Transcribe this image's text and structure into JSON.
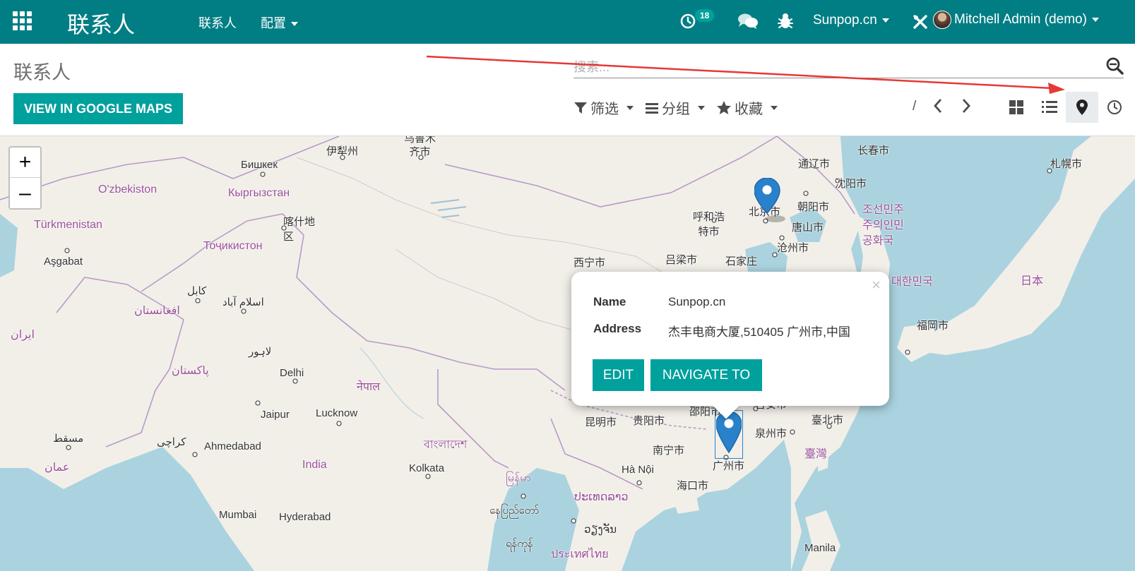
{
  "navbar": {
    "brand": "联系人",
    "menu": [
      "联系人",
      "配置"
    ],
    "activity_count": "18",
    "company": "Sunpop.cn",
    "user": "Mitchell Admin (demo)"
  },
  "control": {
    "breadcrumb": "联系人",
    "search_placeholder": "搜索...",
    "google_maps_button": "VIEW IN GOOGLE MAPS",
    "filters_label": "筛选",
    "groupby_label": "分组",
    "favorites_label": "收藏",
    "pager_value": "/",
    "views": [
      "kanban",
      "list",
      "map",
      "activity"
    ],
    "active_view": "map"
  },
  "map": {
    "labels": {
      "yining": "伊犁州",
      "urumqi": "乌鲁木\n齐市",
      "bishkek": "Бишкек",
      "uzbekistan": "O'zbekiston",
      "kyrgyzstan": "Кыргызстан",
      "kashgar": "喀什地\n区",
      "turkmenistan": "Türkmenistan",
      "tajikistan": "Тоҷикистон",
      "ashgabat": "Aşgabat",
      "kabul": "کابل",
      "afghanistan": "افغانستان",
      "islamabad": "اسلام آباد",
      "iran": "ایران",
      "lahore": "لاہور",
      "delhi": "Delhi",
      "nepal": "नेपाल",
      "pakistan": "پاکستان",
      "jaipur": "Jaipur",
      "lucknow": "Lucknow",
      "karachi": "کراچی",
      "muscat": "مسقط",
      "oman": "عمان",
      "ahmedabad": "Ahmedabad",
      "india": "India",
      "kolkata": "Kolkata",
      "bangladesh": "বাংলাদেশ",
      "myanmar": "မြန်မာ",
      "mumbai": "Mumbai",
      "hyderabad": "Hyderabad",
      "naypyidaw": "နေပြည်တော်",
      "laos": "ປະເທດລາວ",
      "thailand_city": "ວຽງຈັນ",
      "yangon": "ရန်ကုန်",
      "thailand": "ประเทศไทย",
      "tongliao": "通辽市",
      "changchun": "长春市",
      "sapporo": "札幌市",
      "shenyang": "沈阳市",
      "hohhot": "呼和浩\n特市",
      "beijing": "北京市",
      "chaoyang": "朝阳市",
      "north_korea": "조선민주\n주의인민\n공화국",
      "tangshan": "唐山市",
      "cangzhou": "沧州市",
      "xining": "西宁市",
      "luliang": "吕梁市",
      "shijiazhuang": "石家庄",
      "south_korea": "대한민국",
      "japan": "日本",
      "fukuoka": "福岡市",
      "kunming": "昆明市",
      "guiyang": "贵阳市",
      "shaoyang": "邵阳市",
      "jian": "吉安市",
      "taipei": "臺北市",
      "quanzhou": "泉州市",
      "nanning": "南宁市",
      "taiwan": "臺灣",
      "guangzhou": "广州市",
      "hanoi": "Hà Nội",
      "haikou": "海口市",
      "manila": "Manila"
    },
    "zoom_in": "+",
    "zoom_out": "–"
  },
  "popup": {
    "name_label": "Name",
    "name_value": "Sunpop.cn",
    "address_label": "Address",
    "address_value": "杰丰电商大厦,510405 广州市,中国",
    "edit_label": "EDIT",
    "navigate_label": "NAVIGATE TO",
    "close": "×"
  },
  "colors": {
    "navbar": "#017e84",
    "primary_button": "#00a09d",
    "marker": "#2a81cb",
    "annotation_arrow": "#e53935",
    "water": "#aad3df",
    "land": "#f2efe9"
  }
}
